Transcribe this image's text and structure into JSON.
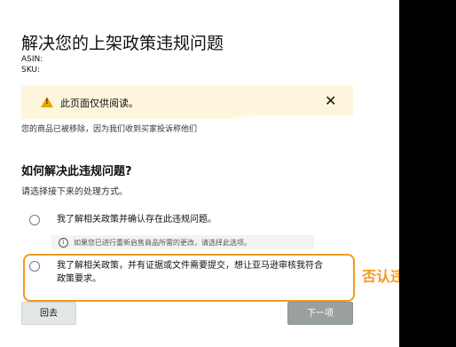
{
  "page": {
    "title": "解决您的上架政策违规问题",
    "asin_label": "ASIN:",
    "sku_label": "SKU:"
  },
  "alert": {
    "icon": "warning-icon",
    "text": "此页面仅供阅读。",
    "close": "✕",
    "accent": "#e6a400",
    "background": "#fdf6dc"
  },
  "removed_text": "您的商品已被移除，因为我们收到买家投诉称他们",
  "section": {
    "heading": "如何解决此违规问题?",
    "subheading": "请选择接下来的处理方式。"
  },
  "options": [
    {
      "text": "我了解相关政策并确认存在此违规问题。",
      "note": "如果您已进行重新启售商品所需的更改，请选择此选项。",
      "note_icon": "info-icon"
    },
    {
      "text_line1": "我了解相关政策，并有证据或文件需要提交，想让亚马逊审核我符合",
      "text_line2": "政策要求。"
    }
  ],
  "buttons": {
    "back": "回去",
    "next": "下一项"
  },
  "annotation": {
    "text": "否认违规",
    "color": "#f39a1e"
  }
}
